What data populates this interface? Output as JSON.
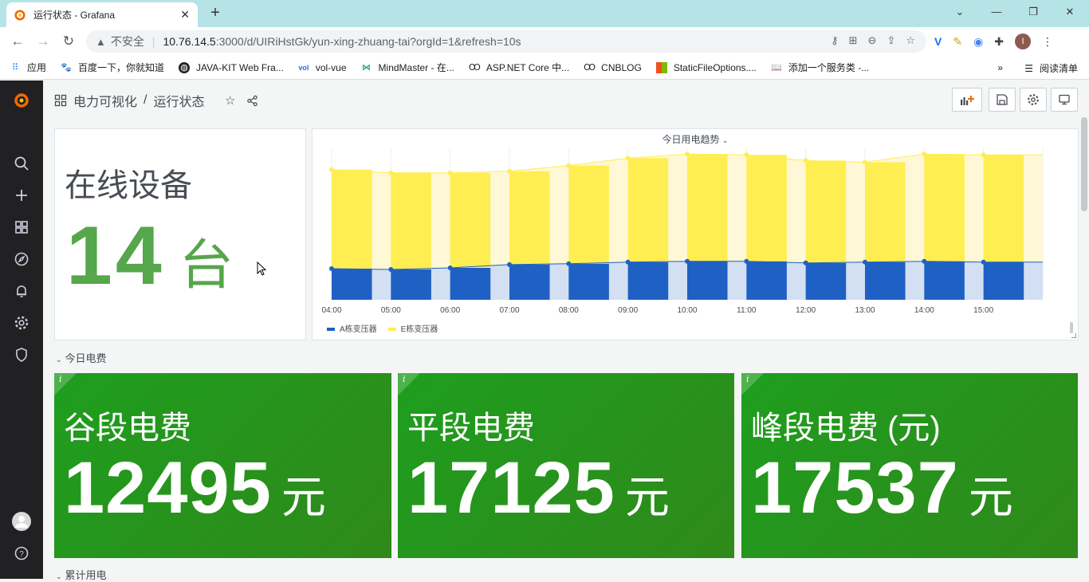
{
  "browser": {
    "tab_title": "运行状态 - Grafana",
    "url_host": "10.76.14.5",
    "url_rest": ":3000/d/UIRiHstGk/yun-xing-zhuang-tai?orgId=1&refresh=10s",
    "insecure_label": "不安全",
    "bookmarks": [
      {
        "label": "应用",
        "icon": "apps-icon"
      },
      {
        "label": "百度一下，你就知道",
        "icon": "baidu-icon"
      },
      {
        "label": "JAVA-KIT Web Fra...",
        "icon": "globe-icon"
      },
      {
        "label": "vol-vue",
        "icon": "vol-icon"
      },
      {
        "label": "MindMaster - 在...",
        "icon": "mindmaster-icon"
      },
      {
        "label": "ASP.NET Core 中...",
        "icon": "aspnet-icon"
      },
      {
        "label": "CNBLOG",
        "icon": "cnblog-icon"
      },
      {
        "label": "StaticFileOptions....",
        "icon": "ms-icon"
      },
      {
        "label": "添加一个服务类 -...",
        "icon": "book-icon"
      }
    ],
    "more_bookmarks": "»",
    "reading_list": "阅读清单"
  },
  "dashboard": {
    "folder": "电力可视化",
    "title": "运行状态"
  },
  "online": {
    "title": "在线设备",
    "value": "14",
    "unit": "台"
  },
  "trend": {
    "title": "今日用电趋势",
    "legend": [
      {
        "name": "A栋变压器",
        "color": "#1f60c4"
      },
      {
        "name": "E栋变压器",
        "color": "#ffee52"
      }
    ]
  },
  "rows": {
    "fees": "今日电费",
    "cumulative": "累计用电"
  },
  "fees": [
    {
      "title": "谷段电费",
      "value": "12495",
      "unit": "元"
    },
    {
      "title": "平段电费",
      "value": "17125",
      "unit": "元"
    },
    {
      "title": "峰段电费 (元)",
      "value": "17537",
      "unit": "元"
    }
  ],
  "chart_data": {
    "type": "bar",
    "title": "今日用电趋势",
    "x": [
      "04:00",
      "05:00",
      "06:00",
      "07:00",
      "08:00",
      "09:00",
      "10:00",
      "11:00",
      "12:00",
      "13:00",
      "14:00",
      "15:00"
    ],
    "xlabel": "",
    "ylabel": "",
    "stacked": true,
    "series": [
      {
        "name": "A栋变压器",
        "color": "#1f60c4",
        "values": [
          38,
          37,
          39,
          43,
          44,
          46,
          47,
          47,
          45,
          46,
          47,
          46
        ]
      },
      {
        "name": "E栋变压器",
        "color": "#ffee52",
        "values": [
          121,
          118,
          116,
          114,
          120,
          127,
          131,
          130,
          125,
          122,
          131,
          131
        ]
      }
    ],
    "ylim": [
      0,
      185
    ],
    "legend_position": "bottom-left"
  }
}
